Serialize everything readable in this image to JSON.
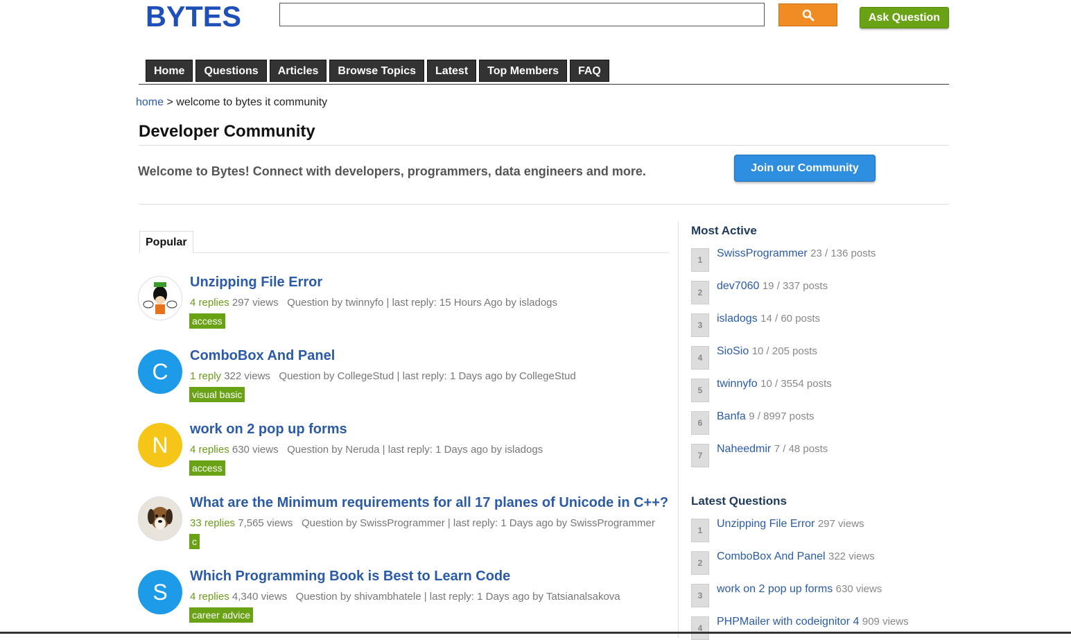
{
  "header": {
    "logo_text": "BYTES",
    "search_placeholder": "",
    "ask_label": "Ask Question"
  },
  "nav": [
    "Home",
    "Questions",
    "Articles",
    "Browse Topics",
    "Latest",
    "Top Members",
    "FAQ"
  ],
  "breadcrumb": {
    "home": "home",
    "sep": ">",
    "current": "welcome to bytes it community"
  },
  "page_title": "Developer Community",
  "welcome_text": "Welcome to Bytes! Connect with developers, programmers, data engineers and more.",
  "join_label": "Join our Community",
  "tab_label": "Popular",
  "questions": [
    {
      "title": "Unzipping File Error",
      "replies": "4 replies",
      "views": "297 views",
      "by": "Question by twinnyfo | last reply: 15 Hours Ago by isladogs",
      "tag": "access",
      "avatar": "goofy",
      "letter": ""
    },
    {
      "title": "ComboBox And Panel",
      "replies": "1 reply",
      "views": "322 views",
      "by": "Question by CollegeStud | last reply: 1 Days ago by CollegeStud",
      "tag": "visual basic",
      "avatar": "letter",
      "letter": "C",
      "color": "#1e9be8"
    },
    {
      "title": "work on 2 pop up forms",
      "replies": "4 replies",
      "views": "630 views",
      "by": "Question by Neruda | last reply: 1 Days ago by isladogs",
      "tag": "access",
      "avatar": "letter",
      "letter": "N",
      "color": "#f5c518"
    },
    {
      "title": "What are the Minimum requirements for all 17 planes of Unicode in C++?",
      "replies": "33 replies",
      "views": "7,565 views",
      "by": "Question by SwissProgrammer | last reply: 1 Days ago by SwissProgrammer",
      "tag": "c",
      "avatar": "dog",
      "letter": ""
    },
    {
      "title": "Which Programming Book is Best to Learn Code",
      "replies": "4 replies",
      "views": "4,340 views",
      "by": "Question by shivambhatele | last reply: 1 Days ago by Tatsianalsakova",
      "tag": "career advice",
      "avatar": "letter",
      "letter": "S",
      "color": "#1e9be8"
    }
  ],
  "most_active": {
    "heading": "Most Active",
    "items": [
      {
        "rank": "1",
        "name": "SwissProgrammer",
        "count": "23 / 136 posts"
      },
      {
        "rank": "2",
        "name": "dev7060",
        "count": "19 / 337 posts"
      },
      {
        "rank": "3",
        "name": "isladogs",
        "count": "14 / 60 posts"
      },
      {
        "rank": "4",
        "name": "SioSio",
        "count": "10 / 205 posts"
      },
      {
        "rank": "5",
        "name": "twinnyfo",
        "count": "10 / 3554 posts"
      },
      {
        "rank": "6",
        "name": "Banfa",
        "count": "9 / 8997 posts"
      },
      {
        "rank": "7",
        "name": "Naheedmir",
        "count": "7 / 48 posts"
      }
    ]
  },
  "latest_questions": {
    "heading": "Latest Questions",
    "items": [
      {
        "rank": "1",
        "name": "Unzipping File Error",
        "count": "297 views"
      },
      {
        "rank": "2",
        "name": "ComboBox And Panel",
        "count": "322 views"
      },
      {
        "rank": "3",
        "name": "work on 2 pop up forms",
        "count": "630 views"
      },
      {
        "rank": "4",
        "name": "PHPMailer with codeignitor 4",
        "count": "909 views"
      }
    ]
  },
  "colors": {
    "accent_green": "#6aa215",
    "search_orange": "#f08c24",
    "link_blue": "#2a5aa8",
    "join_blue": "#2e8ee0"
  }
}
